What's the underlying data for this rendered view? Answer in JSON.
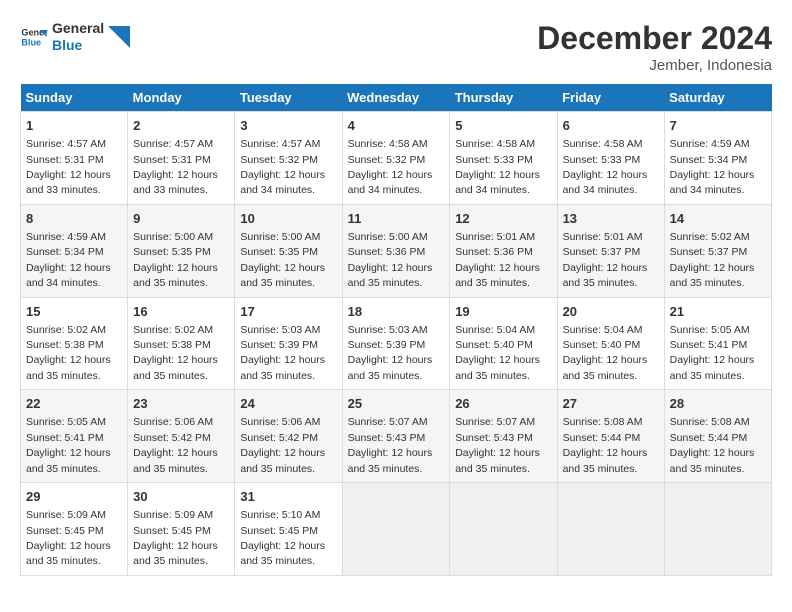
{
  "logo": {
    "line1": "General",
    "line2": "Blue"
  },
  "title": "December 2024",
  "subtitle": "Jember, Indonesia",
  "days_header": [
    "Sunday",
    "Monday",
    "Tuesday",
    "Wednesday",
    "Thursday",
    "Friday",
    "Saturday"
  ],
  "weeks": [
    [
      {
        "day": "1",
        "sunrise": "4:57 AM",
        "sunset": "5:31 PM",
        "daylight": "12 hours and 33 minutes."
      },
      {
        "day": "2",
        "sunrise": "4:57 AM",
        "sunset": "5:31 PM",
        "daylight": "12 hours and 33 minutes."
      },
      {
        "day": "3",
        "sunrise": "4:57 AM",
        "sunset": "5:32 PM",
        "daylight": "12 hours and 34 minutes."
      },
      {
        "day": "4",
        "sunrise": "4:58 AM",
        "sunset": "5:32 PM",
        "daylight": "12 hours and 34 minutes."
      },
      {
        "day": "5",
        "sunrise": "4:58 AM",
        "sunset": "5:33 PM",
        "daylight": "12 hours and 34 minutes."
      },
      {
        "day": "6",
        "sunrise": "4:58 AM",
        "sunset": "5:33 PM",
        "daylight": "12 hours and 34 minutes."
      },
      {
        "day": "7",
        "sunrise": "4:59 AM",
        "sunset": "5:34 PM",
        "daylight": "12 hours and 34 minutes."
      }
    ],
    [
      {
        "day": "8",
        "sunrise": "4:59 AM",
        "sunset": "5:34 PM",
        "daylight": "12 hours and 34 minutes."
      },
      {
        "day": "9",
        "sunrise": "5:00 AM",
        "sunset": "5:35 PM",
        "daylight": "12 hours and 35 minutes."
      },
      {
        "day": "10",
        "sunrise": "5:00 AM",
        "sunset": "5:35 PM",
        "daylight": "12 hours and 35 minutes."
      },
      {
        "day": "11",
        "sunrise": "5:00 AM",
        "sunset": "5:36 PM",
        "daylight": "12 hours and 35 minutes."
      },
      {
        "day": "12",
        "sunrise": "5:01 AM",
        "sunset": "5:36 PM",
        "daylight": "12 hours and 35 minutes."
      },
      {
        "day": "13",
        "sunrise": "5:01 AM",
        "sunset": "5:37 PM",
        "daylight": "12 hours and 35 minutes."
      },
      {
        "day": "14",
        "sunrise": "5:02 AM",
        "sunset": "5:37 PM",
        "daylight": "12 hours and 35 minutes."
      }
    ],
    [
      {
        "day": "15",
        "sunrise": "5:02 AM",
        "sunset": "5:38 PM",
        "daylight": "12 hours and 35 minutes."
      },
      {
        "day": "16",
        "sunrise": "5:02 AM",
        "sunset": "5:38 PM",
        "daylight": "12 hours and 35 minutes."
      },
      {
        "day": "17",
        "sunrise": "5:03 AM",
        "sunset": "5:39 PM",
        "daylight": "12 hours and 35 minutes."
      },
      {
        "day": "18",
        "sunrise": "5:03 AM",
        "sunset": "5:39 PM",
        "daylight": "12 hours and 35 minutes."
      },
      {
        "day": "19",
        "sunrise": "5:04 AM",
        "sunset": "5:40 PM",
        "daylight": "12 hours and 35 minutes."
      },
      {
        "day": "20",
        "sunrise": "5:04 AM",
        "sunset": "5:40 PM",
        "daylight": "12 hours and 35 minutes."
      },
      {
        "day": "21",
        "sunrise": "5:05 AM",
        "sunset": "5:41 PM",
        "daylight": "12 hours and 35 minutes."
      }
    ],
    [
      {
        "day": "22",
        "sunrise": "5:05 AM",
        "sunset": "5:41 PM",
        "daylight": "12 hours and 35 minutes."
      },
      {
        "day": "23",
        "sunrise": "5:06 AM",
        "sunset": "5:42 PM",
        "daylight": "12 hours and 35 minutes."
      },
      {
        "day": "24",
        "sunrise": "5:06 AM",
        "sunset": "5:42 PM",
        "daylight": "12 hours and 35 minutes."
      },
      {
        "day": "25",
        "sunrise": "5:07 AM",
        "sunset": "5:43 PM",
        "daylight": "12 hours and 35 minutes."
      },
      {
        "day": "26",
        "sunrise": "5:07 AM",
        "sunset": "5:43 PM",
        "daylight": "12 hours and 35 minutes."
      },
      {
        "day": "27",
        "sunrise": "5:08 AM",
        "sunset": "5:44 PM",
        "daylight": "12 hours and 35 minutes."
      },
      {
        "day": "28",
        "sunrise": "5:08 AM",
        "sunset": "5:44 PM",
        "daylight": "12 hours and 35 minutes."
      }
    ],
    [
      {
        "day": "29",
        "sunrise": "5:09 AM",
        "sunset": "5:45 PM",
        "daylight": "12 hours and 35 minutes."
      },
      {
        "day": "30",
        "sunrise": "5:09 AM",
        "sunset": "5:45 PM",
        "daylight": "12 hours and 35 minutes."
      },
      {
        "day": "31",
        "sunrise": "5:10 AM",
        "sunset": "5:45 PM",
        "daylight": "12 hours and 35 minutes."
      },
      null,
      null,
      null,
      null
    ]
  ]
}
